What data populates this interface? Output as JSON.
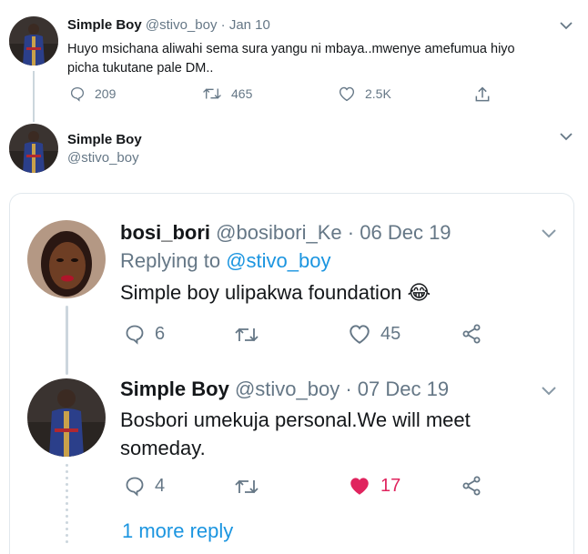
{
  "tweet1": {
    "name": "Simple Boy",
    "handle": "@stivo_boy",
    "dot": "·",
    "date": "Jan 10",
    "text_line1": "Huyo msichana aliwahi sema sura yangu ni mbaya..mwenye amefumua hiyo",
    "text_line2": "picha tukutane pale DM..",
    "replies": "209",
    "retweets": "465",
    "likes": "2.5K"
  },
  "tweet2": {
    "name": "Simple Boy",
    "handle": "@stivo_boy"
  },
  "quoted": {
    "reply1": {
      "name": "bosi_bori",
      "handle": "@bosibori_Ke",
      "dot": "·",
      "date": "06 Dec 19",
      "replying_prefix": "Replying to",
      "replying_handle": "@stivo_boy",
      "text": "Simple boy ulipakwa foundation",
      "emoji": "😂",
      "replies": "6",
      "likes": "45"
    },
    "reply2": {
      "name": "Simple Boy",
      "handle": "@stivo_boy",
      "dot": "·",
      "date": "07 Dec 19",
      "text_line1": "Bosbori umekuja personal.We will meet",
      "text_line2": "someday.",
      "replies": "4",
      "likes": "17"
    },
    "more_replies": "1 more reply"
  },
  "colors": {
    "accent": "#1b95e0",
    "muted": "#657786",
    "liked": "#e0245e",
    "border": "#e1e8ed"
  }
}
